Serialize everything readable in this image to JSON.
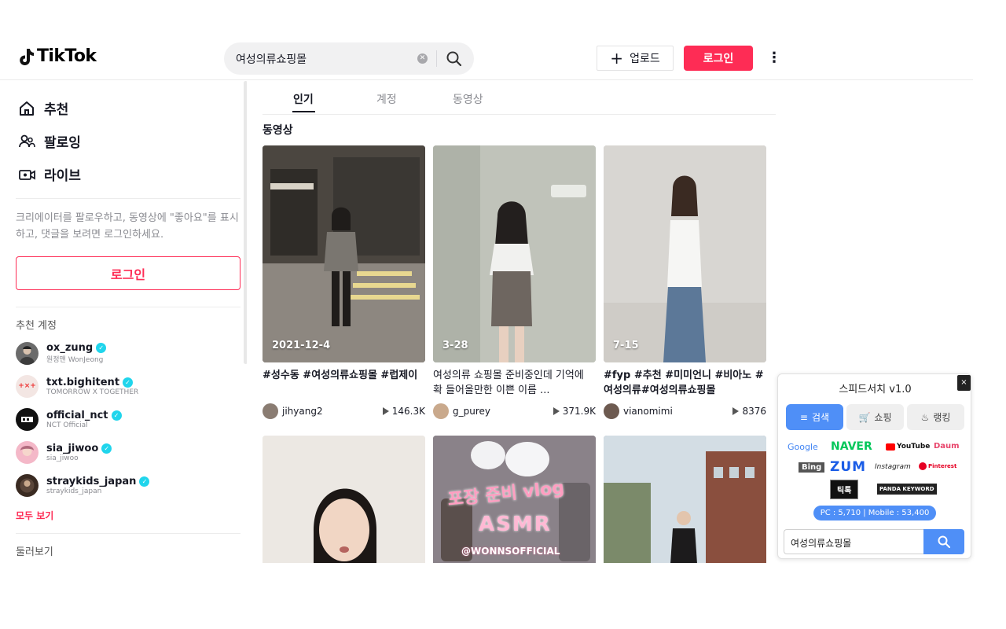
{
  "brand": {
    "name": "TikTok",
    "accent": "#fe2c55"
  },
  "search": {
    "value": "여성의류쇼핑몰"
  },
  "header": {
    "upload_label": "업로드",
    "login_label": "로그인",
    "more_glyph": "⋮"
  },
  "sidebar": {
    "nav": [
      {
        "label": "추천",
        "icon": "home-icon"
      },
      {
        "label": "팔로잉",
        "icon": "following-icon"
      },
      {
        "label": "라이브",
        "icon": "live-icon"
      }
    ],
    "prompt": "크리에이터를 팔로우하고, 동영상에 \"좋아요\"를 표시하고, 댓글을 보려면 로그인하세요.",
    "login_label": "로그인",
    "suggested_title": "추천 계정",
    "accounts": [
      {
        "name": "ox_zung",
        "sub": "원정맨 WonJeong",
        "color": "#6b6b6b"
      },
      {
        "name": "txt.bighitent",
        "sub": "TOMORROW X TOGETHER",
        "color": "#f3e6e3",
        "mark": "+×+"
      },
      {
        "name": "official_nct",
        "sub": "NCT Official",
        "color": "#111111"
      },
      {
        "name": "sia_jiwoo",
        "sub": "sia_jiwoo",
        "color": "#f4b8c8"
      },
      {
        "name": "straykids_japan",
        "sub": "straykids_japan",
        "color": "#3a2b22"
      }
    ],
    "see_all": "모두 보기",
    "explore_title": "둘러보기"
  },
  "tabs": [
    {
      "label": "인기",
      "active": true
    },
    {
      "label": "계정",
      "active": false
    },
    {
      "label": "동영상",
      "active": false
    }
  ],
  "section_title": "동영상",
  "videos": [
    {
      "date": "2021-12-4",
      "desc": "#성수동 #여성의류쇼핑몰 #럽제이",
      "bold": true,
      "user": "jihyang2",
      "views": "146.3K",
      "bg": "#5a5550",
      "avatar": "#8a7c72"
    },
    {
      "date": "3-28",
      "desc": "여성의류 쇼핑몰 준비중인데 기억에 확 들어올만한 이쁜 이름 ...",
      "bold": false,
      "user": "g_purey",
      "views": "371.9K",
      "bg": "#b9bcb4",
      "avatar": "#c9a98c"
    },
    {
      "date": "7-15",
      "desc": "#fyp #추천 #미미언니 #비아노 #여성의류#여성의류쇼핑몰",
      "bold": true,
      "user": "vianomimi",
      "views": "8376",
      "bg": "#b4b2ae",
      "avatar": "#6d5a50"
    },
    {
      "date": "",
      "desc": "",
      "bold": false,
      "user": "",
      "views": "",
      "bg": "#e7e2dc",
      "avatar": "#ccc"
    },
    {
      "date": "",
      "desc": "",
      "bold": false,
      "user": "",
      "views": "",
      "bg": "#7a7479",
      "avatar": "#ccc",
      "overlay_1": "포장 준비 vlog",
      "overlay_2": "ASMR",
      "overlay_3": "@WONNSOFFICIAL"
    },
    {
      "date": "",
      "desc": "",
      "bold": false,
      "user": "",
      "views": "",
      "bg": "#7f8f9a",
      "avatar": "#ccc"
    }
  ],
  "speed_search": {
    "title": "스피드서치 v1.0",
    "close": "×",
    "tabs": [
      {
        "label": "검색",
        "active": true
      },
      {
        "label": "쇼핑",
        "active": false
      },
      {
        "label": "랭킹",
        "active": false
      }
    ],
    "logos": [
      "Google",
      "NAVER",
      "YouTube",
      "Daum",
      "Bing",
      "ZUM",
      "Instagram",
      "Pinterest",
      "틱톡",
      "PANDA KEYWORD"
    ],
    "stats": "PC : 5,710  |  Mobile : 53,400",
    "query": "여성의류쇼핑몰"
  }
}
